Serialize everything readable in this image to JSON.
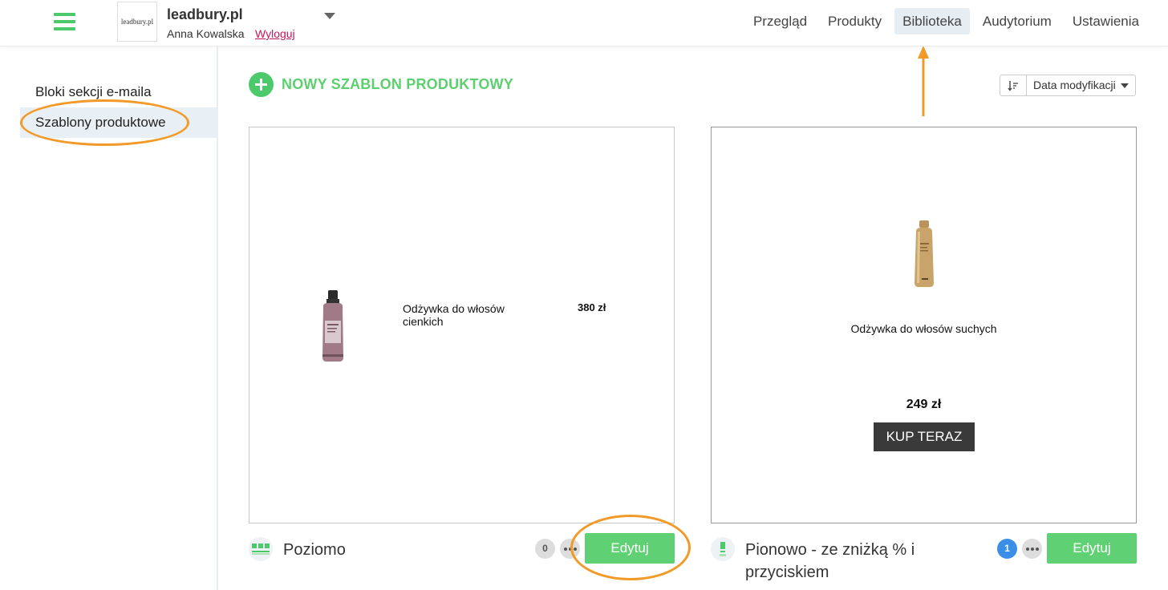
{
  "header": {
    "logo_text": "leadbury.pl",
    "account_name": "leadbury.pl",
    "user_name": "Anna Kowalska",
    "logout_label": "Wyloguj",
    "nav": [
      {
        "label": "Przegląd",
        "active": false
      },
      {
        "label": "Produkty",
        "active": false
      },
      {
        "label": "Biblioteka",
        "active": true
      },
      {
        "label": "Audytorium",
        "active": false
      },
      {
        "label": "Ustawienia",
        "active": false
      }
    ]
  },
  "sidebar": {
    "items": [
      {
        "label": "Bloki sekcji e-maila",
        "active": false
      },
      {
        "label": "Szablony produktowe",
        "active": true
      }
    ]
  },
  "main": {
    "new_template_label": "NOWY SZABLON PRODUKTOWY",
    "sort": {
      "icon": "sort-icon",
      "selected": "Data modyfikacji"
    },
    "templates": [
      {
        "name": "Poziomo",
        "layout": "horizontal",
        "usage_count": "0",
        "edit_label": "Edytuj",
        "preview": {
          "product_name": "Odżywka do włosów cienkich",
          "price": "380 zł"
        }
      },
      {
        "name": "Pionowo - ze zniżką % i przyciskiem",
        "layout": "vertical",
        "usage_count": "1",
        "edit_label": "Edytuj",
        "preview": {
          "product_name": "Odżywka do włosów suchych",
          "price": "249 zł",
          "cta": "KUP TERAZ"
        }
      }
    ]
  },
  "colors": {
    "accent_green": "#4cc96a",
    "annotation_orange": "#f29a28",
    "logout_link": "#c2185b",
    "count_blue": "#3b8ee8"
  }
}
